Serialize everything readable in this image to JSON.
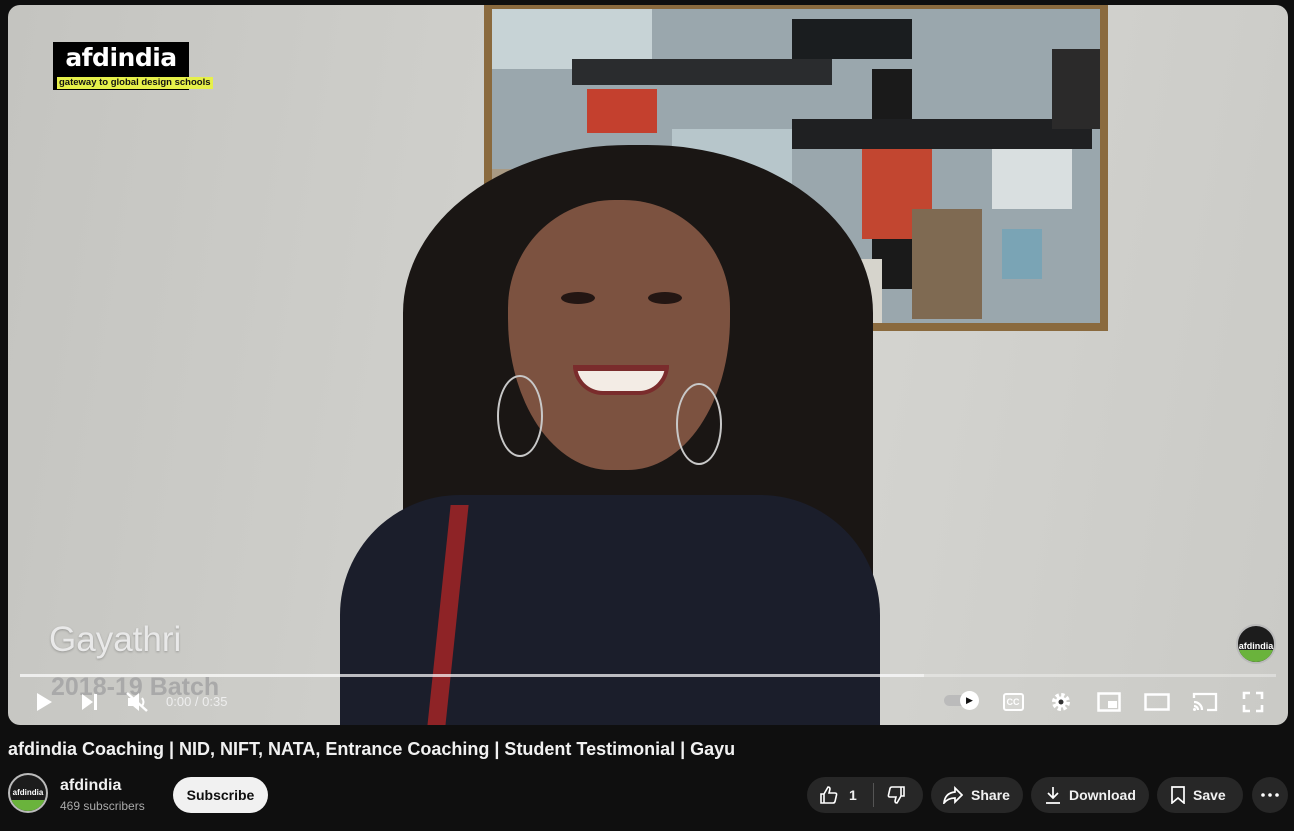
{
  "video": {
    "logo_main": "afdindia",
    "logo_sub": "gateway to global design schools",
    "overlay_name": "Gayathri",
    "overlay_batch": "2018-19 Batch",
    "watermark_text": "afdindia",
    "progress_buffered_fraction": 0.72
  },
  "controls": {
    "time": "0:00 / 0:35",
    "cc_label": "CC",
    "icons": [
      "play-icon",
      "next-icon",
      "mute-icon",
      "autoplay-toggle",
      "cc-icon",
      "settings-icon",
      "miniplayer-icon",
      "theater-icon",
      "cast-icon",
      "fullscreen-icon"
    ]
  },
  "title": "afdindia Coaching | NID, NIFT, NATA, Entrance Coaching | Student Testimonial | Gayu",
  "channel": {
    "avatar_text": "afdindia",
    "name": "afdindia",
    "subscribers": "469 subscribers",
    "subscribe_label": "Subscribe"
  },
  "actions": {
    "like_count": "1",
    "share_label": "Share",
    "download_label": "Download",
    "save_label": "Save"
  },
  "colors": {
    "background": "#0f0f0f",
    "button_bg": "#272727",
    "subscribe_bg": "#f1f1f1",
    "logo_accent": "#e6f04a"
  }
}
